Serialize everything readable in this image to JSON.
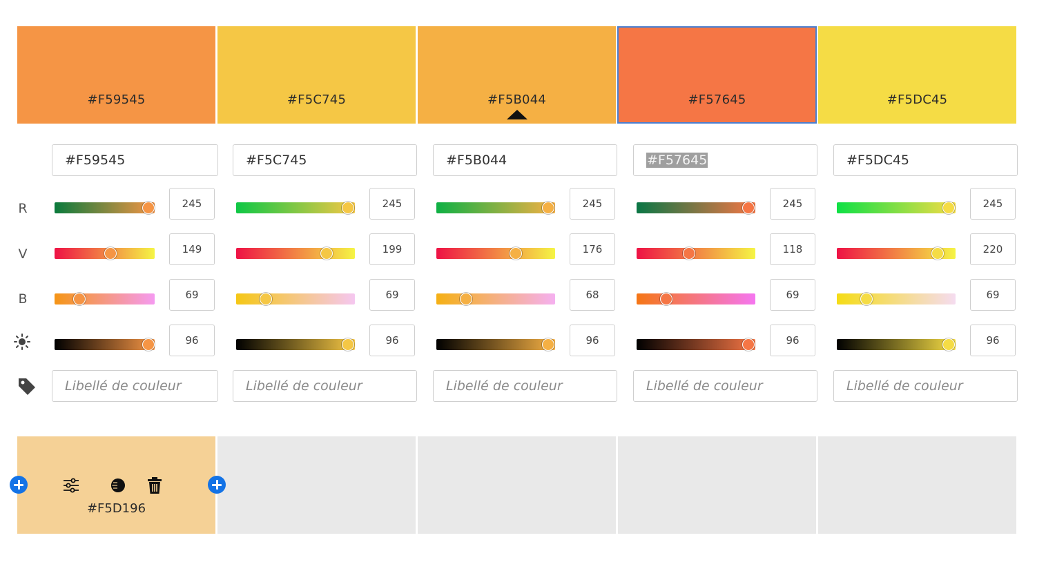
{
  "colors": [
    {
      "hex": "#F59545",
      "fill": "#F59545",
      "selected": false,
      "base": false,
      "channels": {
        "r": "245",
        "v": "149",
        "b": "69",
        "brightness": "96"
      },
      "label_placeholder": "Libellé de couleur"
    },
    {
      "hex": "#F5C745",
      "fill": "#F5C745",
      "selected": false,
      "base": false,
      "channels": {
        "r": "245",
        "v": "199",
        "b": "69",
        "brightness": "96"
      },
      "label_placeholder": "Libellé de couleur"
    },
    {
      "hex": "#F5B044",
      "fill": "#F5B044",
      "selected": false,
      "base": true,
      "channels": {
        "r": "245",
        "v": "176",
        "b": "68",
        "brightness": "96"
      },
      "label_placeholder": "Libellé de couleur"
    },
    {
      "hex": "#F57645",
      "fill": "#F57645",
      "selected": true,
      "base": false,
      "channels": {
        "r": "245",
        "v": "118",
        "b": "69",
        "brightness": "96"
      },
      "label_placeholder": "Libellé de couleur"
    },
    {
      "hex": "#F5DC45",
      "fill": "#F5DC45",
      "selected": false,
      "base": false,
      "channels": {
        "r": "245",
        "v": "220",
        "b": "69",
        "brightness": "96"
      },
      "label_placeholder": "Libellé de couleur"
    }
  ],
  "row_labels": {
    "r": "R",
    "v": "V",
    "b": "B",
    "brightness_icon": "sun-icon",
    "label_icon": "tag-icon"
  },
  "generated_swatch": {
    "hex": "#F5D196",
    "fill": "#F5D196",
    "tools": [
      "sliders-icon",
      "contrast-icon",
      "trash-icon"
    ]
  },
  "add_buttons": [
    "add-color-left-icon",
    "add-color-right-icon"
  ],
  "accent_color": "#1473E6"
}
